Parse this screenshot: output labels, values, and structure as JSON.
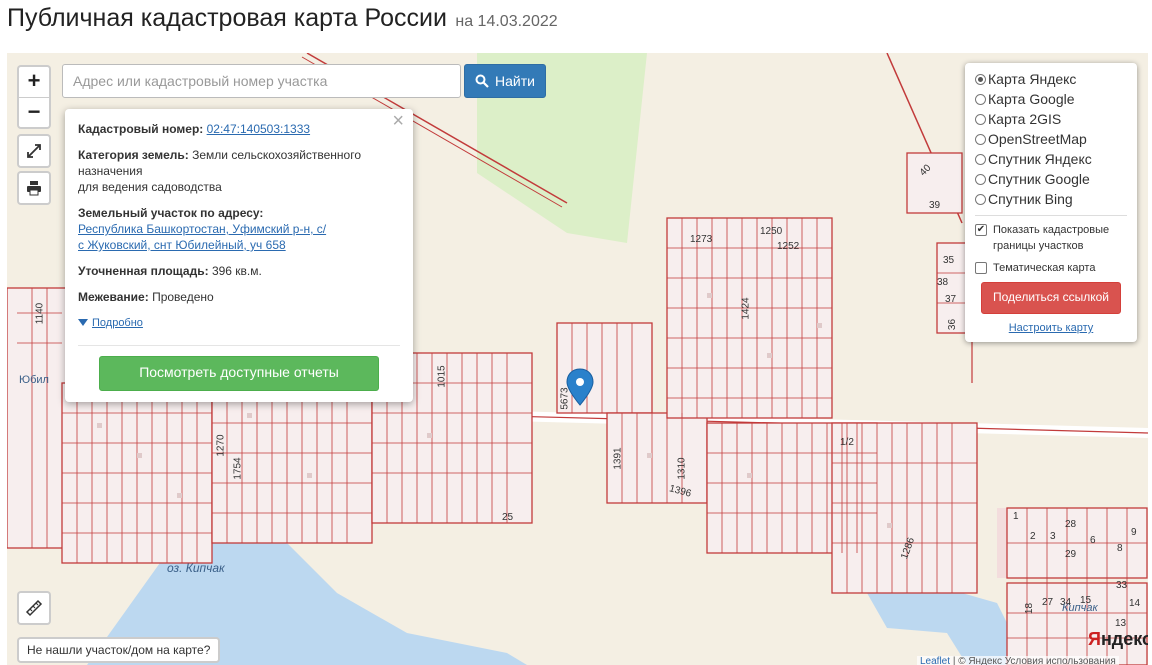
{
  "header": {
    "title": "Публичная кадастровая карта России",
    "date": "на 14.03.2022"
  },
  "search": {
    "placeholder": "Адрес или кадастровый номер участка",
    "button": "Найти"
  },
  "zoom": {
    "in": "+",
    "out": "−"
  },
  "popup": {
    "cad_label": "Кадастровый номер:",
    "cad_value": "02:47:140503:1333",
    "cat_label": "Категория земель:",
    "cat_value": "Земли сельскохозяйственного назначения",
    "cat_use": "для ведения садоводства",
    "addr_label": "Земельный участок по адресу:",
    "addr_line1": "Республика Башкортостан, Уфимский р-н, с/",
    "addr_line2": "с Жуковский, снт Юбилейный, уч 658",
    "area_label": "Уточненная площадь:",
    "area_value": "396 кв.м.",
    "survey_label": "Межевание:",
    "survey_value": "Проведено",
    "more": "Подробно",
    "reports_button": "Посмотреть доступные отчеты"
  },
  "layers": {
    "options": [
      "Карта Яндекс",
      "Карта Google",
      "Карта 2GIS",
      "OpenStreetMap",
      "Спутник Яндекс",
      "Спутник Google",
      "Спутник Bing"
    ],
    "selected": 0,
    "show_borders": "Показать кадастровые границы участков",
    "thematic": "Тематическая карта",
    "share_button": "Поделиться ссылкой",
    "configure": "Настроить карту"
  },
  "map": {
    "lake_label": "оз. Кипчак",
    "village_label": "Кипчак",
    "partial_label": "Юбил",
    "plot_numbers": [
      "1273",
      "1250",
      "1252",
      "1424",
      "1140",
      "1015",
      "1270",
      "1754",
      "5673",
      "1391",
      "1310",
      "1396",
      "1286",
      "1/2",
      "25",
      "40",
      "39",
      "35",
      "38",
      "37",
      "36",
      "1",
      "2",
      "3",
      "28",
      "29",
      "6",
      "8",
      "9",
      "33",
      "18",
      "27",
      "34",
      "15",
      "14",
      "13"
    ]
  },
  "not_found": "Не нашли участок/дом на карте?",
  "attribution": {
    "leaflet": "Leaflet",
    "text": "| © Яндекс Условия использования"
  },
  "yandex_logo": {
    "red": "Я",
    "rest": "ндекс"
  },
  "colors": {
    "parcel_border": "#c23b3b",
    "map_bg": "#f4efe3",
    "forest": "#dcefc8",
    "water": "#bcd8f0",
    "primary": "#337ab7",
    "success": "#5cb85c",
    "danger": "#d9534f"
  }
}
